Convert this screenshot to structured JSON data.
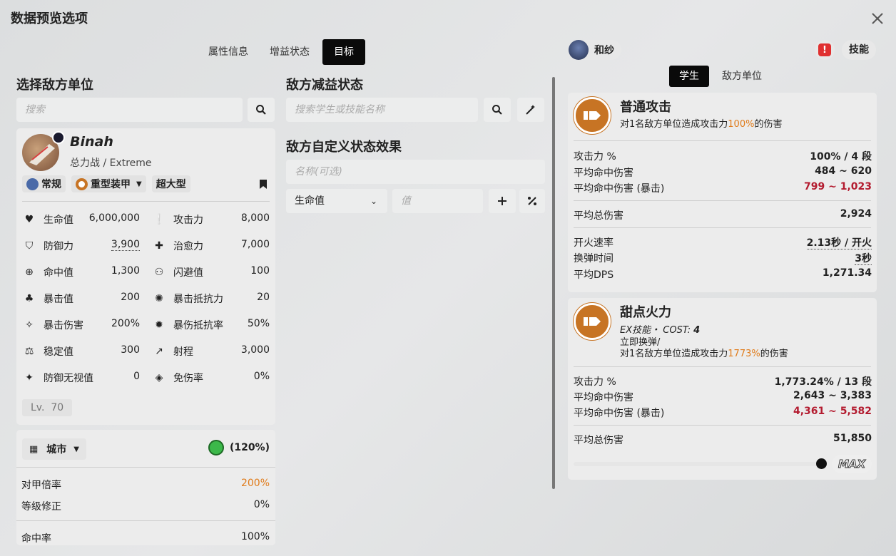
{
  "window": {
    "title": "数据预览选项"
  },
  "tabs": [
    {
      "label": "属性信息",
      "active": false
    },
    {
      "label": "增益状态",
      "active": false
    },
    {
      "label": "目标",
      "active": true
    }
  ],
  "left": {
    "section_title": "选择敌方单位",
    "search_placeholder": "搜索",
    "enemy": {
      "name": "Binah",
      "subtitle": "总力战 / Extreme",
      "tags": {
        "attack_type": "常规",
        "armor_type": "重型装甲",
        "size": "超大型"
      },
      "level_label": "Lv.",
      "level": "70"
    },
    "stats": [
      {
        "icon": "heart-icon",
        "label": "生命值",
        "value": "6,000,000"
      },
      {
        "icon": "attack-icon",
        "label": "攻击力",
        "value": "8,000"
      },
      {
        "icon": "shield-icon",
        "label": "防御力",
        "value": "3,900"
      },
      {
        "icon": "heal-icon",
        "label": "治愈力",
        "value": "7,000"
      },
      {
        "icon": "crosshair-icon",
        "label": "命中值",
        "value": "1,300"
      },
      {
        "icon": "evade-icon",
        "label": "闪避值",
        "value": "100"
      },
      {
        "icon": "crit-icon",
        "label": "暴击值",
        "value": "200"
      },
      {
        "icon": "crit-resist-icon",
        "label": "暴击抵抗力",
        "value": "20"
      },
      {
        "icon": "crit-damage-icon",
        "label": "暴击伤害",
        "value": "200%"
      },
      {
        "icon": "crit-damage-resist-icon",
        "label": "暴伤抵抗率",
        "value": "50%"
      },
      {
        "icon": "stability-icon",
        "label": "稳定值",
        "value": "300"
      },
      {
        "icon": "range-icon",
        "label": "射程",
        "value": "3,000"
      },
      {
        "icon": "def-pierce-icon",
        "label": "防御无视值",
        "value": "0"
      },
      {
        "icon": "damage-reduction-icon",
        "label": "免伤率",
        "value": "0%"
      }
    ],
    "terrain": {
      "label": "城市",
      "mood_value": "(120%)",
      "rows": [
        {
          "label": "对甲倍率",
          "value": "200%"
        },
        {
          "label": "等级修正",
          "value": "0%"
        },
        {
          "label": "命中率",
          "value": "100%"
        }
      ]
    }
  },
  "middle": {
    "debuff_title": "敌方减益状态",
    "debuff_search_placeholder": "搜索学生或技能名称",
    "custom_title": "敌方自定义状态效果",
    "name_placeholder": "名称(可选)",
    "stat_select": "生命值",
    "value_placeholder": "值"
  },
  "right": {
    "student_name": "和纱",
    "skills_label": "技能",
    "subtabs": [
      {
        "label": "学生",
        "active": true
      },
      {
        "label": "敌方单位",
        "active": false
      }
    ],
    "normal_attack": {
      "name": "普通攻击",
      "desc_prefix": "对1名敌方单位造成攻击力",
      "desc_highlight": "100%",
      "desc_suffix": "的伤害",
      "rows1": [
        {
          "label": "攻击力 %",
          "value": "100% / 4 段"
        },
        {
          "label": "平均命中伤害",
          "value": "484 ~ 620"
        },
        {
          "label": "平均命中伤害 (暴击)",
          "value": "799 ~ 1,023"
        }
      ],
      "total_label": "平均总伤害",
      "total_value": "2,924",
      "rows2": [
        {
          "label": "开火速率",
          "value": "2.13秒 / 开火"
        },
        {
          "label": "换弹时间",
          "value": "3秒"
        },
        {
          "label": "平均DPS",
          "value": "1,271.34"
        }
      ]
    },
    "ex_skill": {
      "name": "甜点火力",
      "type_label": "EX技能・",
      "cost_label": "COST:",
      "cost_value": "4",
      "desc_line1": "立即换弹/",
      "desc_prefix": "对1名敌方单位造成攻击力",
      "desc_highlight": "1773%",
      "desc_suffix": "的伤害",
      "rows": [
        {
          "label": "攻击力 %",
          "value": "1,773.24% / 13 段"
        },
        {
          "label": "平均命中伤害",
          "value": "2,643 ~ 3,383"
        },
        {
          "label": "平均命中伤害 (暴击)",
          "value": "4,361 ~ 5,582"
        }
      ],
      "total_label": "平均总伤害",
      "total_value": "51,850",
      "level_fraction": 1.0,
      "max_label": "MAX"
    }
  },
  "colors": {
    "accent_orange": "#c77424",
    "crit_red": "#b31b2f",
    "highlight_orange": "#e07b1a"
  }
}
